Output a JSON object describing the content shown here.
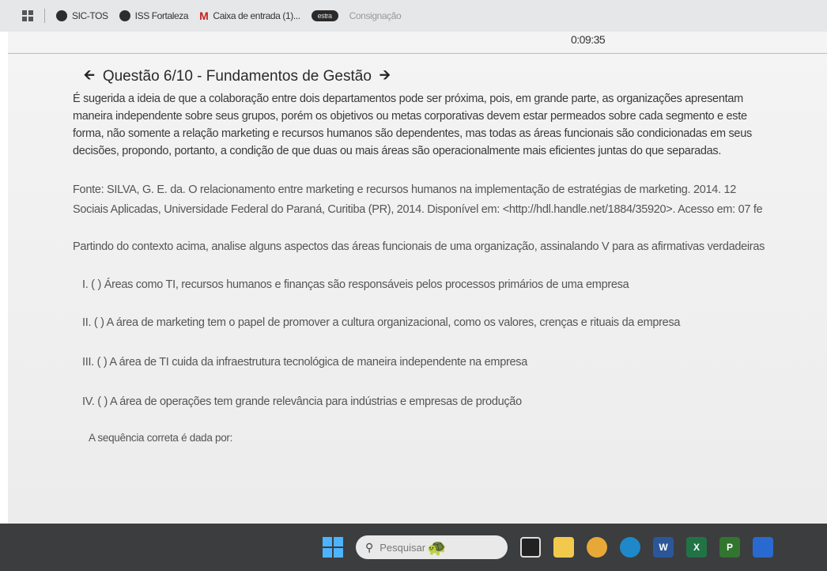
{
  "bookmarks": [
    {
      "label": "SIC-TOS"
    },
    {
      "label": "ISS Fortaleza"
    },
    {
      "label": "Caixa de entrada (1)..."
    },
    {
      "label": "estra"
    },
    {
      "label": "Consignação"
    }
  ],
  "timer": "0:09:35",
  "question": {
    "title": "Questão 6/10 - Fundamentos de Gestão",
    "intro_lines": [
      "É sugerida a ideia de que a colaboração entre dois departamentos pode ser próxima, pois, em grande parte, as organizações apresentam",
      "maneira independente sobre seus grupos, porém os objetivos ou metas corporativas devem estar permeados sobre cada segmento e este",
      "forma, não somente a relação marketing e recursos humanos são dependentes, mas todas as áreas funcionais são condicionadas em seus",
      "decisões, propondo, portanto, a condição de que duas ou mais áreas são operacionalmente mais eficientes juntas do que separadas."
    ],
    "source_lines": [
      "Fonte: SILVA, G. E. da. O relacionamento entre marketing e recursos humanos na implementação de estratégias de marketing. 2014. 12",
      "Sociais Aplicadas, Universidade Federal do Paraná, Curitiba (PR), 2014. Disponível em: <http://hdl.handle.net/1884/35920>. Acesso em: 07 fe"
    ],
    "prompt": "Partindo do contexto acima, analise alguns aspectos das áreas funcionais de uma organização, assinalando V para as afirmativas verdadeiras",
    "statements": [
      "I. ( ) Áreas como TI, recursos humanos e finanças são responsáveis pelos processos primários de uma empresa",
      "II. ( ) A área de marketing tem o papel de promover a cultura organizacional, como os valores, crenças e rituais da empresa",
      "III. ( ) A área de TI cuida da infraestrutura tecnológica de maneira independente na empresa",
      "IV. ( ) A área de operações tem grande relevância para indústrias e empresas de produção"
    ],
    "answer_prompt": "A sequência correta é dada por:"
  },
  "taskbar": {
    "search_placeholder": "Pesquisar",
    "apps": [
      {
        "icon": "explorer-icon",
        "color": "#f2c94c"
      },
      {
        "icon": "chrome-icon",
        "color": "#e8a838"
      },
      {
        "icon": "edge-icon",
        "color": "#1e88c9"
      },
      {
        "icon": "word-icon",
        "color": "#2b579a"
      },
      {
        "icon": "excel-icon",
        "color": "#217346"
      },
      {
        "icon": "project-icon",
        "color": "#31752f"
      },
      {
        "icon": "remote-icon",
        "color": "#2a6ad0"
      }
    ]
  }
}
